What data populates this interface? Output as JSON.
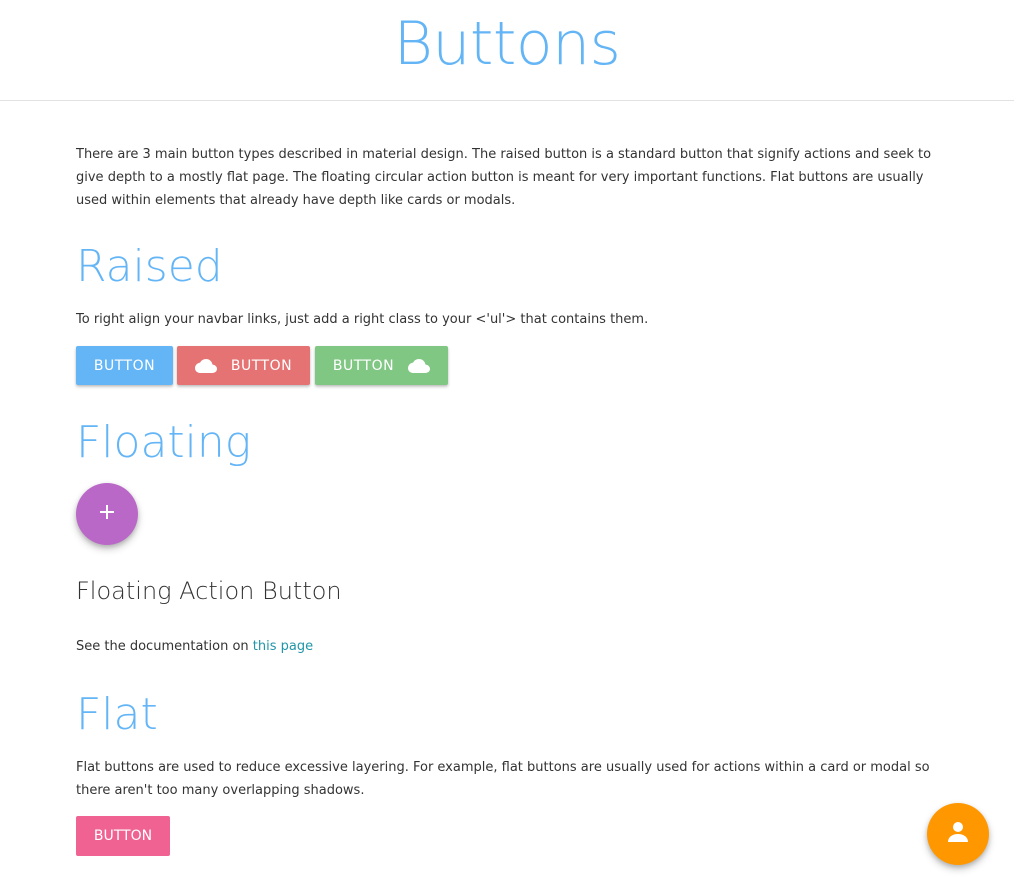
{
  "header": {
    "title": "Buttons"
  },
  "intro": {
    "text": "There are 3 main button types described in material design. The raised button is a standard button that signify actions and seek to give depth to a mostly flat page. The floating circular action button is meant for very important functions. Flat buttons are usually used within elements that already have depth like cards or modals."
  },
  "raised": {
    "heading": "Raised",
    "description": "To right align your navbar links, just add a right class to your <'ul'> that contains them.",
    "buttons": [
      {
        "label": "BUTTON",
        "color": "#64b5f6",
        "icon": null
      },
      {
        "label": "BUTTON",
        "color": "#e57373",
        "icon": "cloud-icon",
        "icon_position": "left"
      },
      {
        "label": "BUTTON",
        "color": "#81c784",
        "icon": "cloud-icon",
        "icon_position": "right"
      }
    ]
  },
  "floating": {
    "heading": "Floating",
    "fab_icon": "plus-icon",
    "fab_color": "#ba68c8",
    "subheading": "Floating Action Button",
    "doc_prefix": "See the documentation on ",
    "doc_link": "this page"
  },
  "flat": {
    "heading": "Flat",
    "description": "Flat buttons are used to reduce excessive layering. For example, flat buttons are usually used for actions within a card or modal so there aren't too many overlapping shadows.",
    "button_label": "BUTTON",
    "button_color": "#f06292"
  },
  "corner_fab": {
    "icon": "person-icon",
    "color": "#ff9800"
  },
  "colors": {
    "accent": "#64b5f6",
    "link": "#2196a8"
  }
}
